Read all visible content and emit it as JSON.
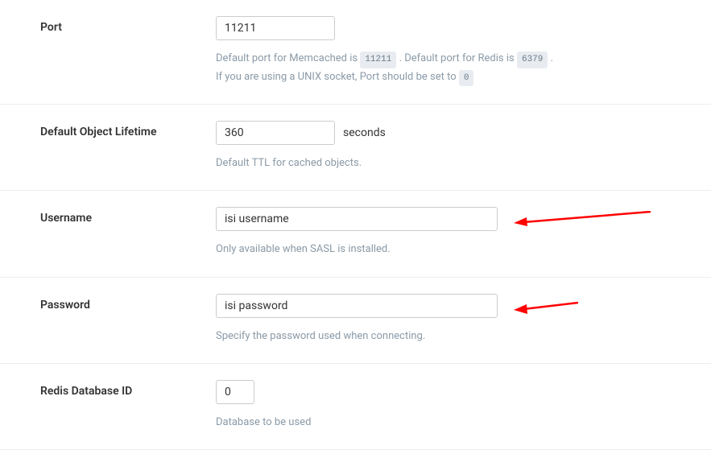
{
  "fields": {
    "port": {
      "label": "Port",
      "value": "11211",
      "help_prefix": "Default port for Memcached is ",
      "memcached_port": "11211",
      "help_mid": " . Default port for Redis is ",
      "redis_port": "6379",
      "help_suffix": " .",
      "help_line2_prefix": "If you are using a UNIX socket, Port should be set to ",
      "unix_port": "0"
    },
    "lifetime": {
      "label": "Default Object Lifetime",
      "value": "360",
      "unit": "seconds",
      "help": "Default TTL for cached objects."
    },
    "username": {
      "label": "Username",
      "value": "isi username",
      "help": "Only available when SASL is installed."
    },
    "password": {
      "label": "Password",
      "value": "isi password",
      "help": "Specify the password used when connecting."
    },
    "redis_db": {
      "label": "Redis Database ID",
      "value": "0",
      "help": "Database to be used"
    }
  }
}
